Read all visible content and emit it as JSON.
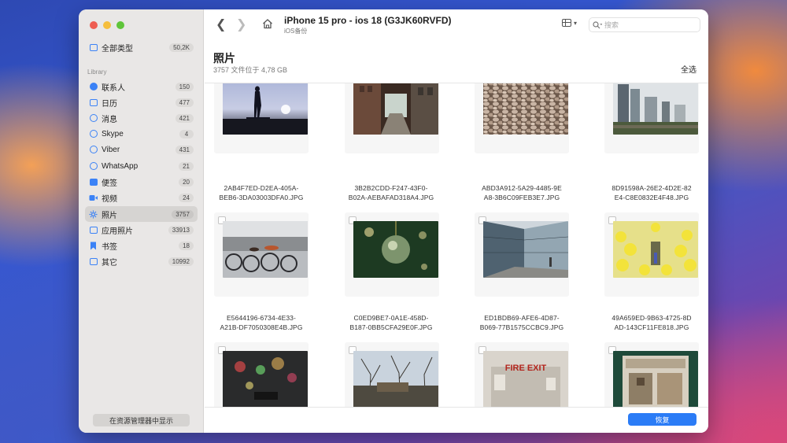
{
  "window_title": "iPhone 15 pro - ios 18 (G3JK60RVFD)",
  "window_subtitle": "iOS备份",
  "search": {
    "placeholder": "搜索"
  },
  "sidebar": {
    "all": {
      "label": "全部类型",
      "count": "50,2K",
      "icon": "folder-icon"
    },
    "library_header": "Library",
    "items": [
      {
        "label": "联系人",
        "count": "150",
        "icon": "contacts-icon"
      },
      {
        "label": "日历",
        "count": "477",
        "icon": "calendar-icon"
      },
      {
        "label": "消息",
        "count": "421",
        "icon": "messages-icon"
      },
      {
        "label": "Skype",
        "count": "4",
        "icon": "skype-icon"
      },
      {
        "label": "Viber",
        "count": "431",
        "icon": "viber-icon"
      },
      {
        "label": "WhatsApp",
        "count": "21",
        "icon": "whatsapp-icon"
      },
      {
        "label": "便签",
        "count": "20",
        "icon": "notes-icon"
      },
      {
        "label": "视频",
        "count": "24",
        "icon": "video-icon"
      },
      {
        "label": "照片",
        "count": "3757",
        "icon": "photos-icon",
        "selected": true
      },
      {
        "label": "应用照片",
        "count": "33913",
        "icon": "app-photos-icon"
      },
      {
        "label": "书签",
        "count": "18",
        "icon": "bookmark-icon"
      },
      {
        "label": "其它",
        "count": "10992",
        "icon": "other-icon"
      }
    ],
    "reveal_button": "在资源管理器中显示"
  },
  "main": {
    "section_title": "照片",
    "section_subtitle": "3757 文件位于 4,78 GB",
    "select_all": "全选",
    "recover_button": "恢复",
    "photos": [
      {
        "name_line1": "2AB4F7ED-D2EA-405A-",
        "name_line2": "BEB6-3DA03003DFA0.JPG",
        "scene": "skater-silhouette"
      },
      {
        "name_line1": "3B2B2CDD-F247-43F0-",
        "name_line2": "B02A-AEBAFAD318A4.JPG",
        "scene": "alley"
      },
      {
        "name_line1": "ABD3A912-5A29-4485-9E",
        "name_line2": "A8-3B6C09FEB3E7.JPG",
        "scene": "pebbles"
      },
      {
        "name_line1": "8D91598A-26E2-4D2E-82",
        "name_line2": "E4-C8E0832E4F48.JPG",
        "scene": "city-skyline"
      },
      {
        "name_line1": "E5644196-6734-4E33-",
        "name_line2": "A21B-DF7050308E4B.JPG",
        "scene": "bicycles"
      },
      {
        "name_line1": "C0ED9BE7-0A1E-458D-",
        "name_line2": "B187-0BB5CFA29E0F.JPG",
        "scene": "christmas-bauble"
      },
      {
        "name_line1": "ED1BDB69-AFE6-4D87-",
        "name_line2": "B069-77B1575CCBC9.JPG",
        "scene": "glass-building"
      },
      {
        "name_line1": "49A659ED-9B63-4725-8D",
        "name_line2": "AD-143CF11FE818.JPG",
        "scene": "yellow-balloons"
      },
      {
        "name_line1": "",
        "name_line2": "",
        "scene": "bokeh-lights"
      },
      {
        "name_line1": "",
        "name_line2": "",
        "scene": "bare-trees"
      },
      {
        "name_line1": "",
        "name_line2": "",
        "scene": "fire-exit"
      },
      {
        "name_line1": "",
        "name_line2": "",
        "scene": "shop-window"
      }
    ],
    "fire_exit_text": "FIRE EXIT"
  },
  "colors": {
    "accent": "#2b7cf6",
    "sidebar_icon": "#3b82f6",
    "traffic_red": "#ee5d52",
    "traffic_yellow": "#f5be3d",
    "traffic_green": "#5fc53a"
  }
}
